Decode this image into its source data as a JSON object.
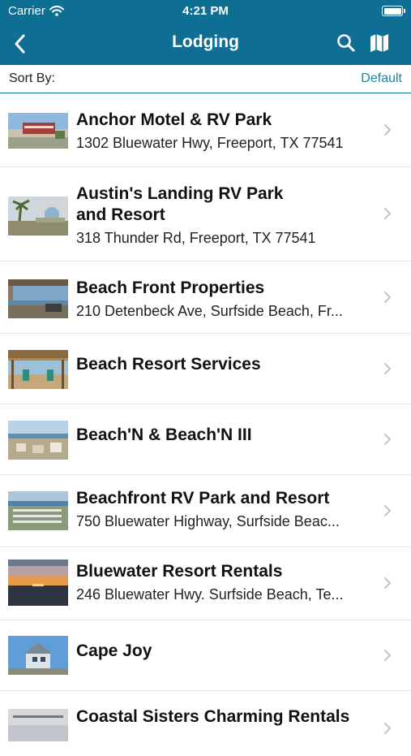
{
  "status_bar": {
    "carrier": "Carrier",
    "time": "4:21 PM"
  },
  "nav": {
    "title": "Lodging"
  },
  "sort": {
    "label": "Sort By:",
    "value": "Default"
  },
  "colors": {
    "header": "#0e6e94",
    "accent": "#1a86a8"
  },
  "listings": [
    {
      "name": "Anchor Motel & RV Park",
      "address": "1302 Bluewater Hwy, Freeport, TX 77541"
    },
    {
      "name": "Austin's Landing RV Park",
      "name2": "and Resort",
      "address": "318 Thunder Rd, Freeport, TX 77541"
    },
    {
      "name": "Beach Front Properties",
      "address": "210 Detenbeck Ave, Surfside Beach, Fr..."
    },
    {
      "name": "Beach Resort Services"
    },
    {
      "name": "Beach'N & Beach'N III"
    },
    {
      "name": "Beachfront RV Park and Resort",
      "address": "750 Bluewater Highway, Surfside Beac..."
    },
    {
      "name": "Bluewater Resort Rentals",
      "address": "246 Bluewater Hwy. Surfside Beach, Te..."
    },
    {
      "name": "Cape Joy"
    },
    {
      "name": "Coastal Sisters Charming Rentals"
    }
  ]
}
